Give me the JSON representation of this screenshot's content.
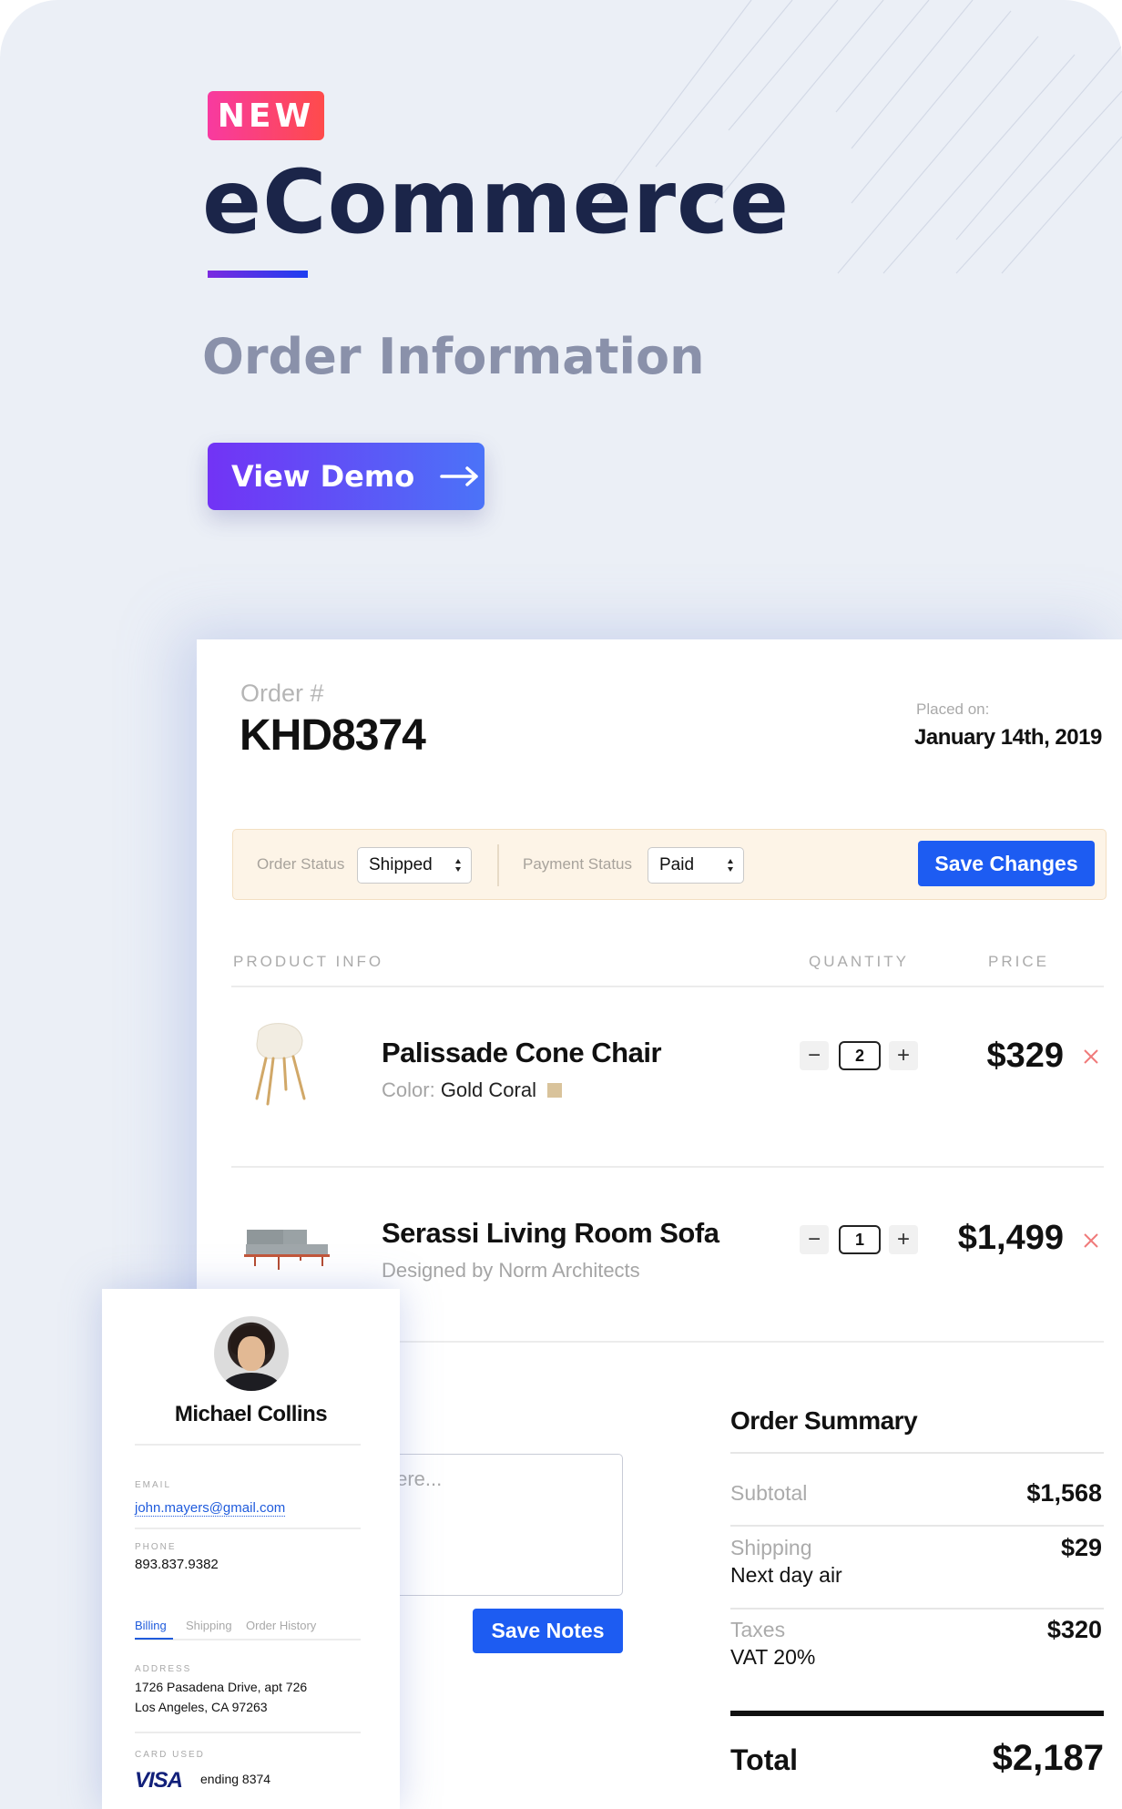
{
  "hero": {
    "badge": "NEW",
    "title": "eCommerce",
    "subtitle": "Order Information",
    "demo_button": "View Demo",
    "demo_icon": "arrow-right-icon"
  },
  "order": {
    "label": "Order #",
    "id": "KHD8374",
    "placed_label": "Placed on:",
    "placed_date": "January 14th, 2019"
  },
  "status_bar": {
    "order_status_label": "Order Status",
    "order_status_value": "Shipped",
    "payment_status_label": "Payment Status",
    "payment_status_value": "Paid",
    "save_button": "Save Changes"
  },
  "table": {
    "headers": [
      "PRODUCT INFO",
      "QUANTITY",
      "PRICE"
    ],
    "items": [
      {
        "name": "Palissade Cone Chair",
        "sub_label": "Color:",
        "sub_value": "Gold Coral",
        "swatch_color": "#d9c39b",
        "quantity": "2",
        "price": "$329",
        "image_icon": "chair-icon"
      },
      {
        "name": "Serassi Living Room Sofa",
        "sub_label": "Designed by Norm Architects",
        "quantity": "1",
        "price": "$1,499",
        "image_icon": "sofa-icon"
      }
    ],
    "minus": "−",
    "plus": "+"
  },
  "notes": {
    "placeholder": "Write your notes here...",
    "save_button": "Save Notes"
  },
  "summary": {
    "title": "Order Summary",
    "subtotal_label": "Subtotal",
    "subtotal_value": "$1,568",
    "shipping_label": "Shipping",
    "shipping_method": "Next day air",
    "shipping_value": "$29",
    "taxes_label": "Taxes",
    "taxes_detail": "VAT 20%",
    "taxes_value": "$320",
    "total_label": "Total",
    "total_value": "$2,187"
  },
  "customer": {
    "name": "Michael Collins",
    "email_label": "EMAIL",
    "email": "john.mayers@gmail.com",
    "phone_label": "PHONE",
    "phone": "893.837.9382",
    "tabs": [
      "Billing",
      "Shipping",
      "Order History"
    ],
    "active_tab": "Billing",
    "address_label": "ADDRESS",
    "address_line1": "1726 Pasadena Drive, apt 726",
    "address_line2": "Los Angeles, CA 97263",
    "card_label": "CARD USED",
    "card_brand": "VISA",
    "card_ending": "ending 8374"
  },
  "colors": {
    "accent_blue": "#1d5cf2",
    "badge_gradient": [
      "#f83aa0",
      "#fe4b4b"
    ],
    "demo_gradient": [
      "#7233f5",
      "#4b73f8"
    ],
    "title_navy": "#1b2549",
    "remove_red": "#f07a7a",
    "status_bar_bg": "#fdf4e7"
  }
}
